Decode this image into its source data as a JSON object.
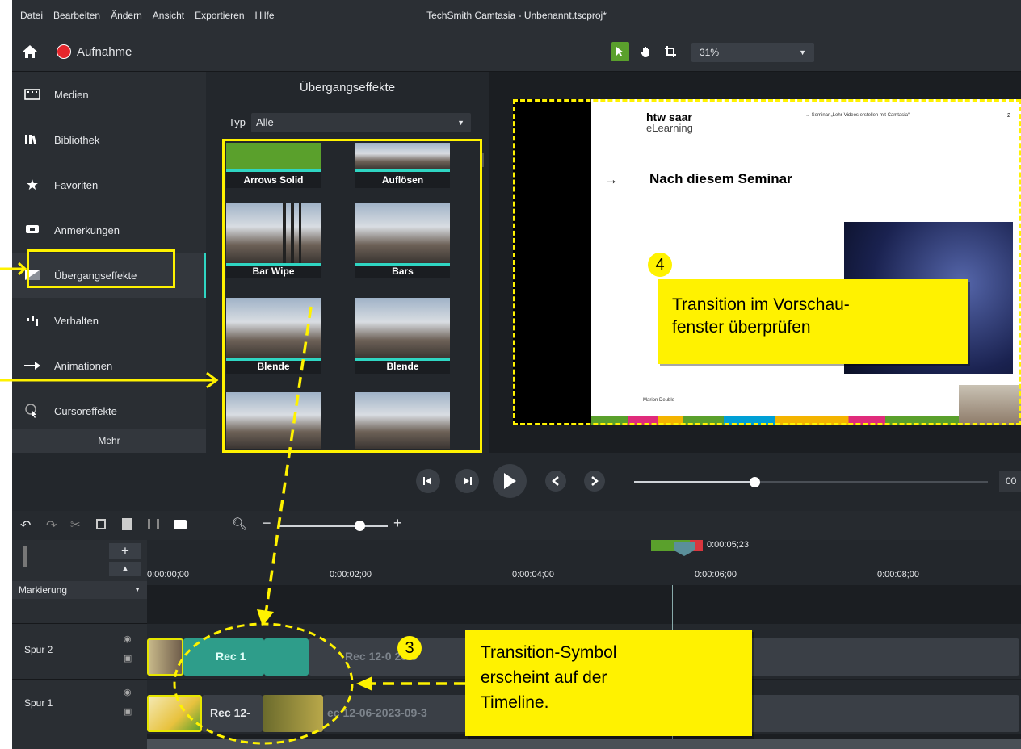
{
  "menu": [
    "Datei",
    "Bearbeiten",
    "Ändern",
    "Ansicht",
    "Exportieren",
    "Hilfe"
  ],
  "window_title": "TechSmith Camtasia - Unbenannt.tscproj*",
  "record_label": "Aufnahme",
  "zoom_value": "31%",
  "nav": {
    "items": [
      "Medien",
      "Bibliothek",
      "Favoriten",
      "Anmerkungen",
      "Übergangseffekte",
      "Verhalten",
      "Animationen",
      "Cursoreffekte"
    ],
    "more": "Mehr"
  },
  "effects": {
    "title": "Übergangseffekte",
    "type_label": "Typ",
    "type_value": "Alle",
    "thumbs": [
      "Arrows Solid",
      "Auflösen",
      "Bar Wipe",
      "Bars",
      "Blende",
      "Blende"
    ]
  },
  "slide": {
    "logo_line1": "htw saar",
    "logo_line2": "eLearning",
    "header_text": "→ Seminar „Lehr-Videos erstellen mit Camtasia“",
    "page_num": "2",
    "arrow": "→",
    "heading": "Nach diesem Seminar",
    "footer_name": "Marion Deuble"
  },
  "playback": {
    "time_partial": "00"
  },
  "timeline": {
    "playhead_time": "0:00:05;23",
    "ticks": [
      "0:00:00;00",
      "0:00:02;00",
      "0:00:04;00",
      "0:00:06;00",
      "0:00:08;00"
    ],
    "marker_label": "Markierung",
    "tracks": [
      "Spur 2",
      "Spur 1"
    ],
    "clips": {
      "track2_a": "Rec 1",
      "track2_b": "Rec 12-0  23-0",
      "track1_a": "Rec 12-",
      "track1_b": "ec 12-06-2023-09-3"
    },
    "plus": "+",
    "minus": "−"
  },
  "annotations": {
    "num4": "4",
    "callout4": [
      "Transition im Vorschau-",
      "fenster überprüfen"
    ],
    "num3": "3",
    "callout3": [
      "Transition-Symbol",
      "erscheint auf der",
      "Timeline."
    ]
  },
  "colors": {
    "highlight": "#fff200",
    "accent_green": "#5aa02c",
    "teal": "#2fd5c2"
  }
}
